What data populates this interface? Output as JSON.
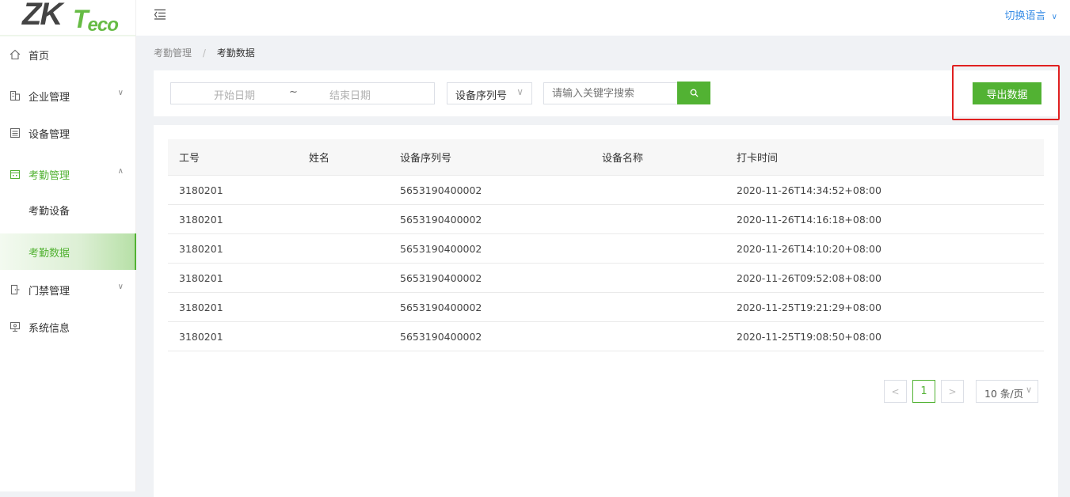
{
  "logo": {
    "zk": "ZK",
    "t": "T",
    "eco": "eco"
  },
  "topbar": {
    "language_label": "切换语言",
    "language_chevron": "∨"
  },
  "sidebar": {
    "items": [
      {
        "label": "首页",
        "icon": "home-icon"
      },
      {
        "label": "企业管理",
        "icon": "building-icon",
        "chevron": "∨"
      },
      {
        "label": "设备管理",
        "icon": "device-icon"
      },
      {
        "label": "考勤管理",
        "icon": "calendar-icon",
        "chevron": "∧"
      },
      {
        "label": "门禁管理",
        "icon": "door-icon",
        "chevron": "∨"
      },
      {
        "label": "系统信息",
        "icon": "monitor-icon"
      }
    ],
    "submenu": [
      {
        "label": "考勤设备"
      },
      {
        "label": "考勤数据"
      }
    ]
  },
  "breadcrumb": {
    "parent": "考勤管理",
    "separator": "/",
    "current": "考勤数据"
  },
  "filter": {
    "start_placeholder": "开始日期",
    "tilde": "~",
    "end_placeholder": "结束日期",
    "select_value": "设备序列号",
    "select_chevron": "∨",
    "search_placeholder": "请输入关键字搜索",
    "export_label": "导出数据"
  },
  "table": {
    "headers": [
      "工号",
      "姓名",
      "设备序列号",
      "设备名称",
      "打卡时间"
    ],
    "rows": [
      [
        "3180201",
        "",
        "5653190400002",
        "",
        "2020-11-26T14:34:52+08:00"
      ],
      [
        "3180201",
        "",
        "5653190400002",
        "",
        "2020-11-26T14:16:18+08:00"
      ],
      [
        "3180201",
        "",
        "5653190400002",
        "",
        "2020-11-26T14:10:20+08:00"
      ],
      [
        "3180201",
        "",
        "5653190400002",
        "",
        "2020-11-26T09:52:08+08:00"
      ],
      [
        "3180201",
        "",
        "5653190400002",
        "",
        "2020-11-25T19:21:29+08:00"
      ],
      [
        "3180201",
        "",
        "5653190400002",
        "",
        "2020-11-25T19:08:50+08:00"
      ]
    ]
  },
  "pagination": {
    "prev": "<",
    "page": "1",
    "next": ">",
    "page_size": "10 条/页",
    "size_chevron": "∨"
  },
  "colors": {
    "accent": "#52b233",
    "link": "#3a8ee6",
    "highlight": "#e02020"
  }
}
